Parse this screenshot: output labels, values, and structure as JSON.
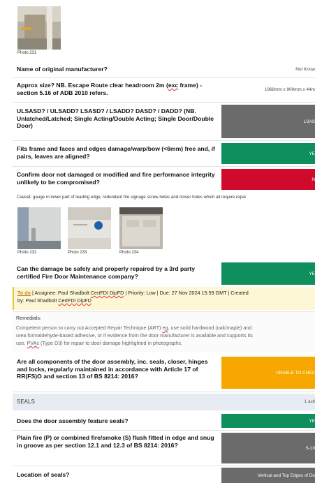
{
  "colors": {
    "green": "#0f8f5e",
    "red": "#cf0a2c",
    "grey": "#6b6b6b",
    "amber": "#f7a800"
  },
  "photos": {
    "p231": "Photo 231",
    "p232": "Photo 232",
    "p233": "Photo 233",
    "p234": "Photo 234"
  },
  "items": [
    {
      "question": "Name of original manufacturer?",
      "answer": "Not Know"
    },
    {
      "question_a": "Approx size? NB. Escape Route clear headroom 2m (",
      "question_spell": "exc",
      "question_b": " frame) - section 5.16 of ADB 2010 refers.",
      "answer": "1968mm x 900mm x 44m"
    },
    {
      "question": "ULSASD? / ULSADD? LSASD? / LSADD? DASD? / DADD? (NB. Unlatched/Latched; Single Acting/Double Acting; Single Door/Double Door)",
      "answer": "LSAS"
    },
    {
      "question": "Fits frame and faces and edges damage/warp/bow (<6mm) free and, if pairs, leaves are aligned?",
      "answer": "YE"
    },
    {
      "question": "Confirm door not damaged or modified and fire performance integrity unlikely to be compromised?",
      "answer": "N"
    },
    {
      "question": "Can the damage be safely and properly repaired by a 3rd party certified Fire Door Maintenance company?",
      "answer": "YE"
    },
    {
      "question": "Are all components of the door assembly, inc. seals, closer, hinges and locks, regularly maintained in accordance with Article 17 of RR(FS)O and section 13 of BS 8214: 2016?",
      "answer": "UNABLE TO CHEC"
    },
    {
      "question": "Does the door assembly feature seals?",
      "answer": "YE"
    },
    {
      "question": "Plain fire (P) or combined fire/smoke (S) flush fitted in edge and snug in groove as per section 12.1 and 12.3 of BS 8214: 2016?",
      "answer": "S-10"
    },
    {
      "question": "Location of seals?",
      "answer": "Vertical and Top Edges of Do"
    }
  ],
  "caveat": "Caveat: gauge in lower part of leading edge, redundant fire signage screw holes and closer holes which all require repai",
  "todo": {
    "link": "To do",
    "line1": " | Assignee: Paul Shadbolt ",
    "cert1": "CertFDI DipFD",
    "line2": " | Priority: Low | Due: 27 Nov 2024 15:59 GMT | Created",
    "line3": "by: Paul Shadbolt ",
    "cert2": "CertFDI DipFD"
  },
  "remedials": {
    "label": "Remedials:",
    "line1a": "Competent person to carry out Accepted Repair Technique (ART) ",
    "line1spell": "eg",
    "line1b": ", use solid hardwood (oak/maple) and",
    "line2": "urea formaldehyde-based adhesive, or if evidence from the door manufacturer is available and supports its",
    "line3a": "use, ",
    "line3spell": "PVAc",
    "line3b": " (Type D3) for repair to door damage highlighted in photographs."
  },
  "section": {
    "title": "SEALS",
    "count": "1 acti"
  }
}
